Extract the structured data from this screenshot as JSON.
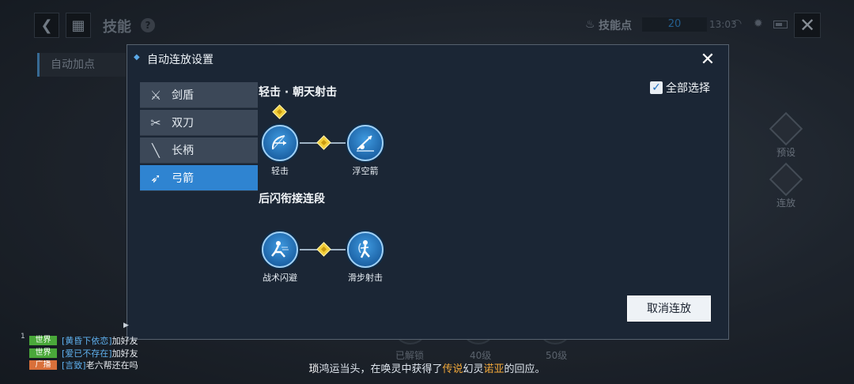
{
  "header": {
    "title": "技能",
    "skill_points_label": "技能点",
    "skill_points_value": "20",
    "clock": "13:03"
  },
  "left_tab": {
    "label": "自动加点"
  },
  "side_buttons": {
    "preset": "预设",
    "combo": "连放"
  },
  "background_nodes": {
    "unlocked": "已解锁",
    "lv40": "40级",
    "lv50": "50级"
  },
  "modal": {
    "title": "自动连放设置",
    "select_all_label": "全部选择",
    "select_all_checked": true,
    "cancel_label": "取消连放",
    "weapon_tabs": [
      {
        "label": "剑盾",
        "icon": "sword-shield-icon",
        "active": false
      },
      {
        "label": "双刀",
        "icon": "dual-blades-icon",
        "active": false
      },
      {
        "label": "长柄",
        "icon": "polearm-icon",
        "active": false
      },
      {
        "label": "弓箭",
        "icon": "bow-icon",
        "active": true
      }
    ],
    "combos": [
      {
        "title": "轻击 · 朝天射击",
        "skills": [
          {
            "label": "轻击",
            "icon": "bow-icon"
          },
          {
            "label": "浮空箭",
            "icon": "sky-shot-icon"
          }
        ]
      },
      {
        "title": "后闪衔接连段",
        "skills": [
          {
            "label": "战术闪避",
            "icon": "dodge-icon"
          },
          {
            "label": "滑步射击",
            "icon": "slide-shot-icon"
          }
        ]
      }
    ]
  },
  "chat": {
    "count": "1",
    "messages": [
      {
        "channel": "世界",
        "channel_color": "#4aa83a",
        "name": "[黄昏下依恋]",
        "text": "加好友"
      },
      {
        "channel": "世界",
        "channel_color": "#4aa83a",
        "name": "[爱已不存在]",
        "text": "加好友"
      },
      {
        "channel": "广播",
        "channel_color": "#d9703a",
        "name": "[言致]",
        "text": "老六帮还在吗"
      }
    ]
  },
  "broadcast": {
    "player": "琐",
    "part1": "鸿运当头，在唤灵中获得了",
    "rarity": "传说",
    "part2": "幻灵",
    "spirit": "诺亚",
    "part3": "的回应。"
  },
  "colors": {
    "accent_blue": "#2f84d1",
    "modal_bg": "#1b2635",
    "gold": "#f3cf3a"
  }
}
